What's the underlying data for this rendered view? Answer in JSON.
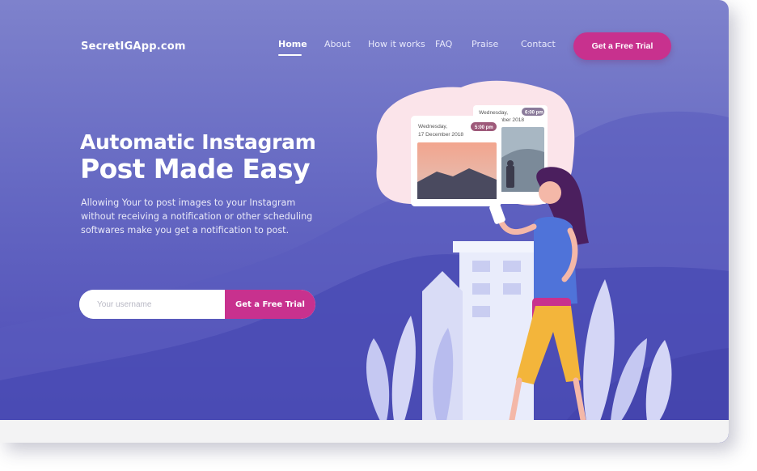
{
  "brand": {
    "logo_text": "SecretIGApp.com"
  },
  "nav": {
    "items": [
      {
        "label": "Home",
        "active": true
      },
      {
        "label": "About"
      },
      {
        "label": "How it works"
      },
      {
        "label": "FAQ"
      },
      {
        "label": "Praise"
      },
      {
        "label": "Contact"
      }
    ],
    "cta_label": "Get a Free Trial"
  },
  "hero": {
    "title_line1": "Automatic Instagram",
    "title_line2": "Post Made Easy",
    "description": "Allowing Your to post images to your Instagram without receiving a notification or other scheduling softwares make you get a notification to post.",
    "signup": {
      "placeholder": "Your username",
      "button_label": "Get a Free Trial"
    }
  },
  "illustration": {
    "front_post": {
      "day": "Wednesday,",
      "date": "17 December 2018",
      "time": "5:00 pm"
    },
    "back_post": {
      "day": "Wednesday,",
      "date": "17 December 2018",
      "time": "6:00 pm"
    }
  },
  "colors": {
    "accent": "#c8318e",
    "bg_top": "#7e82cc",
    "bg_bottom": "#4b48b5",
    "pink_blob": "#fbe4ea"
  }
}
